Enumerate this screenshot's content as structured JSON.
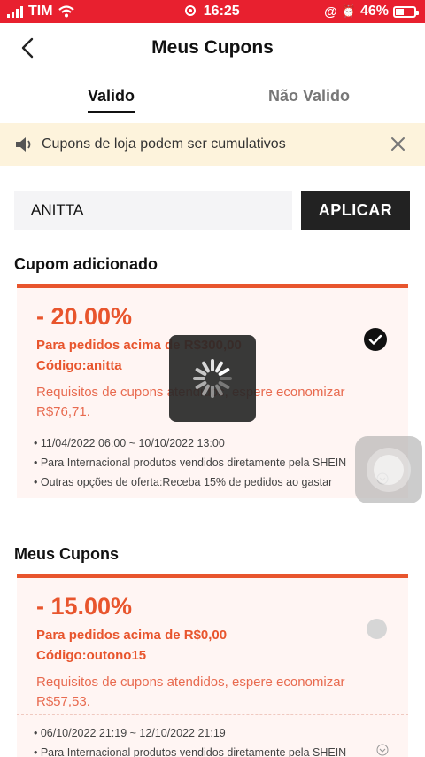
{
  "status": {
    "carrier": "TIM",
    "time": "16:25",
    "battery": "46%",
    "battery_level": 0.46
  },
  "header": {
    "title": "Meus Cupons"
  },
  "tabs": {
    "valid": "Valido",
    "invalid": "Não Valido"
  },
  "notice": {
    "text": "Cupons de loja podem ser cumulativos"
  },
  "coupon_input": {
    "value": "ANITTA",
    "apply_label": "APLICAR"
  },
  "sections": {
    "added": "Cupom adicionado",
    "mine": "Meus Cupons"
  },
  "added_coupon": {
    "discount": "- 20.00%",
    "min_order": "Para pedidos acima de R$300,00",
    "code": "Código:anitta",
    "requirement": "Requisitos de cupons atendidos, espere economizar R$76,71.",
    "selected": true,
    "details": [
      "• 11/04/2022 06:00 ~ 10/10/2022 13:00",
      "• Para Internacional produtos vendidos diretamente pela SHEIN",
      "• Outras opções de oferta:Receba 15% de pedidos ao gastar"
    ]
  },
  "my_coupon": {
    "discount": "- 15.00%",
    "min_order": "Para pedidos acima de R$0,00",
    "code": "Código:outono15",
    "requirement": "Requisitos de cupons atendidos, espere economizar R$57,53.",
    "selected": false,
    "details": [
      "• 06/10/2022 21:19 ~ 12/10/2022 21:19",
      "• Para Internacional produtos vendidos diretamente pela SHEIN"
    ]
  },
  "colors": {
    "status_bar": "#e8202f",
    "accent": "#e8552d",
    "notice_bg": "#fdf3dc",
    "card_bg": "#fff5f3"
  }
}
